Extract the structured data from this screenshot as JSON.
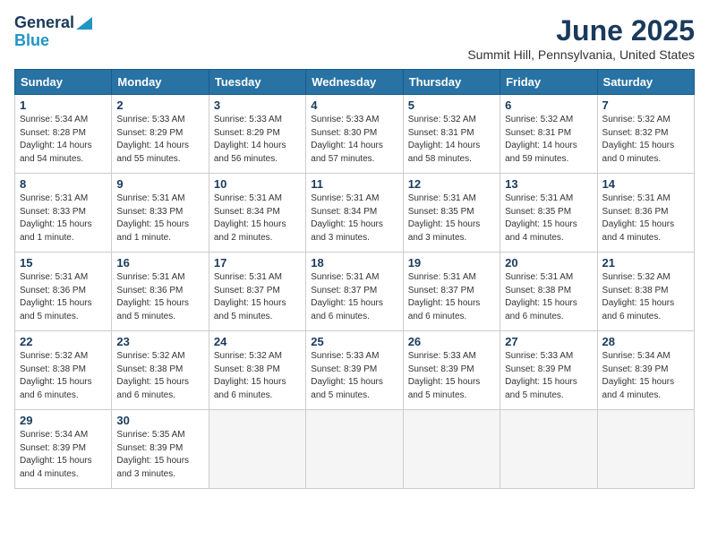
{
  "header": {
    "logo_line1": "General",
    "logo_line2": "Blue",
    "title": "June 2025",
    "subtitle": "Summit Hill, Pennsylvania, United States"
  },
  "calendar": {
    "weekdays": [
      "Sunday",
      "Monday",
      "Tuesday",
      "Wednesday",
      "Thursday",
      "Friday",
      "Saturday"
    ],
    "weeks": [
      [
        {
          "day": "1",
          "info": "Sunrise: 5:34 AM\nSunset: 8:28 PM\nDaylight: 14 hours\nand 54 minutes."
        },
        {
          "day": "2",
          "info": "Sunrise: 5:33 AM\nSunset: 8:29 PM\nDaylight: 14 hours\nand 55 minutes."
        },
        {
          "day": "3",
          "info": "Sunrise: 5:33 AM\nSunset: 8:29 PM\nDaylight: 14 hours\nand 56 minutes."
        },
        {
          "day": "4",
          "info": "Sunrise: 5:33 AM\nSunset: 8:30 PM\nDaylight: 14 hours\nand 57 minutes."
        },
        {
          "day": "5",
          "info": "Sunrise: 5:32 AM\nSunset: 8:31 PM\nDaylight: 14 hours\nand 58 minutes."
        },
        {
          "day": "6",
          "info": "Sunrise: 5:32 AM\nSunset: 8:31 PM\nDaylight: 14 hours\nand 59 minutes."
        },
        {
          "day": "7",
          "info": "Sunrise: 5:32 AM\nSunset: 8:32 PM\nDaylight: 15 hours\nand 0 minutes."
        }
      ],
      [
        {
          "day": "8",
          "info": "Sunrise: 5:31 AM\nSunset: 8:33 PM\nDaylight: 15 hours\nand 1 minute."
        },
        {
          "day": "9",
          "info": "Sunrise: 5:31 AM\nSunset: 8:33 PM\nDaylight: 15 hours\nand 1 minute."
        },
        {
          "day": "10",
          "info": "Sunrise: 5:31 AM\nSunset: 8:34 PM\nDaylight: 15 hours\nand 2 minutes."
        },
        {
          "day": "11",
          "info": "Sunrise: 5:31 AM\nSunset: 8:34 PM\nDaylight: 15 hours\nand 3 minutes."
        },
        {
          "day": "12",
          "info": "Sunrise: 5:31 AM\nSunset: 8:35 PM\nDaylight: 15 hours\nand 3 minutes."
        },
        {
          "day": "13",
          "info": "Sunrise: 5:31 AM\nSunset: 8:35 PM\nDaylight: 15 hours\nand 4 minutes."
        },
        {
          "day": "14",
          "info": "Sunrise: 5:31 AM\nSunset: 8:36 PM\nDaylight: 15 hours\nand 4 minutes."
        }
      ],
      [
        {
          "day": "15",
          "info": "Sunrise: 5:31 AM\nSunset: 8:36 PM\nDaylight: 15 hours\nand 5 minutes."
        },
        {
          "day": "16",
          "info": "Sunrise: 5:31 AM\nSunset: 8:36 PM\nDaylight: 15 hours\nand 5 minutes."
        },
        {
          "day": "17",
          "info": "Sunrise: 5:31 AM\nSunset: 8:37 PM\nDaylight: 15 hours\nand 5 minutes."
        },
        {
          "day": "18",
          "info": "Sunrise: 5:31 AM\nSunset: 8:37 PM\nDaylight: 15 hours\nand 6 minutes."
        },
        {
          "day": "19",
          "info": "Sunrise: 5:31 AM\nSunset: 8:37 PM\nDaylight: 15 hours\nand 6 minutes."
        },
        {
          "day": "20",
          "info": "Sunrise: 5:31 AM\nSunset: 8:38 PM\nDaylight: 15 hours\nand 6 minutes."
        },
        {
          "day": "21",
          "info": "Sunrise: 5:32 AM\nSunset: 8:38 PM\nDaylight: 15 hours\nand 6 minutes."
        }
      ],
      [
        {
          "day": "22",
          "info": "Sunrise: 5:32 AM\nSunset: 8:38 PM\nDaylight: 15 hours\nand 6 minutes."
        },
        {
          "day": "23",
          "info": "Sunrise: 5:32 AM\nSunset: 8:38 PM\nDaylight: 15 hours\nand 6 minutes."
        },
        {
          "day": "24",
          "info": "Sunrise: 5:32 AM\nSunset: 8:38 PM\nDaylight: 15 hours\nand 6 minutes."
        },
        {
          "day": "25",
          "info": "Sunrise: 5:33 AM\nSunset: 8:39 PM\nDaylight: 15 hours\nand 5 minutes."
        },
        {
          "day": "26",
          "info": "Sunrise: 5:33 AM\nSunset: 8:39 PM\nDaylight: 15 hours\nand 5 minutes."
        },
        {
          "day": "27",
          "info": "Sunrise: 5:33 AM\nSunset: 8:39 PM\nDaylight: 15 hours\nand 5 minutes."
        },
        {
          "day": "28",
          "info": "Sunrise: 5:34 AM\nSunset: 8:39 PM\nDaylight: 15 hours\nand 4 minutes."
        }
      ],
      [
        {
          "day": "29",
          "info": "Sunrise: 5:34 AM\nSunset: 8:39 PM\nDaylight: 15 hours\nand 4 minutes."
        },
        {
          "day": "30",
          "info": "Sunrise: 5:35 AM\nSunset: 8:39 PM\nDaylight: 15 hours\nand 3 minutes."
        },
        {
          "day": "",
          "info": ""
        },
        {
          "day": "",
          "info": ""
        },
        {
          "day": "",
          "info": ""
        },
        {
          "day": "",
          "info": ""
        },
        {
          "day": "",
          "info": ""
        }
      ]
    ]
  }
}
